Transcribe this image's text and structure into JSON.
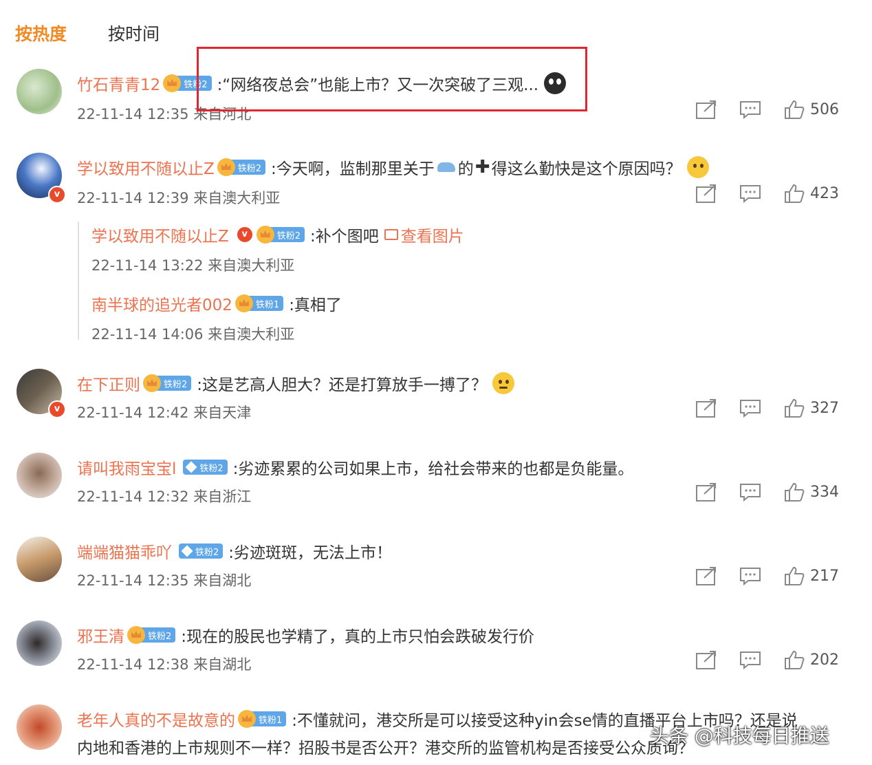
{
  "tabs": [
    {
      "label": "按热度",
      "active": true
    },
    {
      "label": "按时间",
      "active": false
    }
  ],
  "colors": {
    "accent": "#f08a24",
    "username": "#eb7350",
    "highlight": "#e0272e",
    "badge": "#5ea6e8"
  },
  "comments": [
    {
      "user": "竹石青青12",
      "badge": "铁粉2",
      "text": ":“网络夜总会”也能上市？又一次突破了三观...",
      "emoji": "dark-crying-face",
      "time": "22-11-14 12:35 来自河北",
      "likes": "506"
    },
    {
      "user": "学以致用不随以止Z",
      "badge": "铁粉2",
      "text": ":今天啊，监制那里关于",
      "text2": "的",
      "text3": "得这么勤快是这个原因吗？",
      "emoji": "thinking-face",
      "time": "22-11-14 12:39 来自澳大利亚",
      "likes": "423"
    },
    {
      "user": "在下正则",
      "badge": "铁粉2",
      "text": ":这是艺高人胆大？还是打算放手一搏了？",
      "emoji": "sweat-face",
      "time": "22-11-14 12:42 来自天津",
      "likes": "327"
    },
    {
      "user": "请叫我雨宝宝l",
      "badge": "铁粉2",
      "text": ":劣迹累累的公司如果上市，给社会带来的也都是负能量。",
      "time": "22-11-14 12:32 来自浙江",
      "likes": "334"
    },
    {
      "user": "端端猫猫乖吖",
      "badge": "铁粉2",
      "text": ":劣迹斑斑，无法上市！",
      "time": "22-11-14 12:35 来自湖北",
      "likes": "217"
    },
    {
      "user": "邪王清",
      "badge": "铁粉2",
      "text": ":现在的股民也学精了，真的上市只怕会跌破发行价",
      "time": "22-11-14 12:38 来自湖北",
      "likes": "202"
    },
    {
      "user": "老年人真的不是故意的",
      "badge": "铁粉1",
      "text": ":不懂就问，港交所是可以接受这种yin会se情的直播平台上市吗？还是说",
      "text_line2": "内地和香港的上市规则不一样？招股书是否公开？港交所的监管机构是否接受公众质询？"
    }
  ],
  "sub_replies": [
    {
      "user": "学以致用不随以止Z",
      "badge": "铁粉2",
      "text": ":补个图吧",
      "link": "查看图片",
      "time": "22-11-14 13:22 来自澳大利亚"
    },
    {
      "user": "南半球的追光者002",
      "badge": "铁粉1",
      "text": ":真相了",
      "time": "22-11-14 14:06 来自澳大利亚"
    }
  ],
  "watermark": "头条 @科技每日推送"
}
